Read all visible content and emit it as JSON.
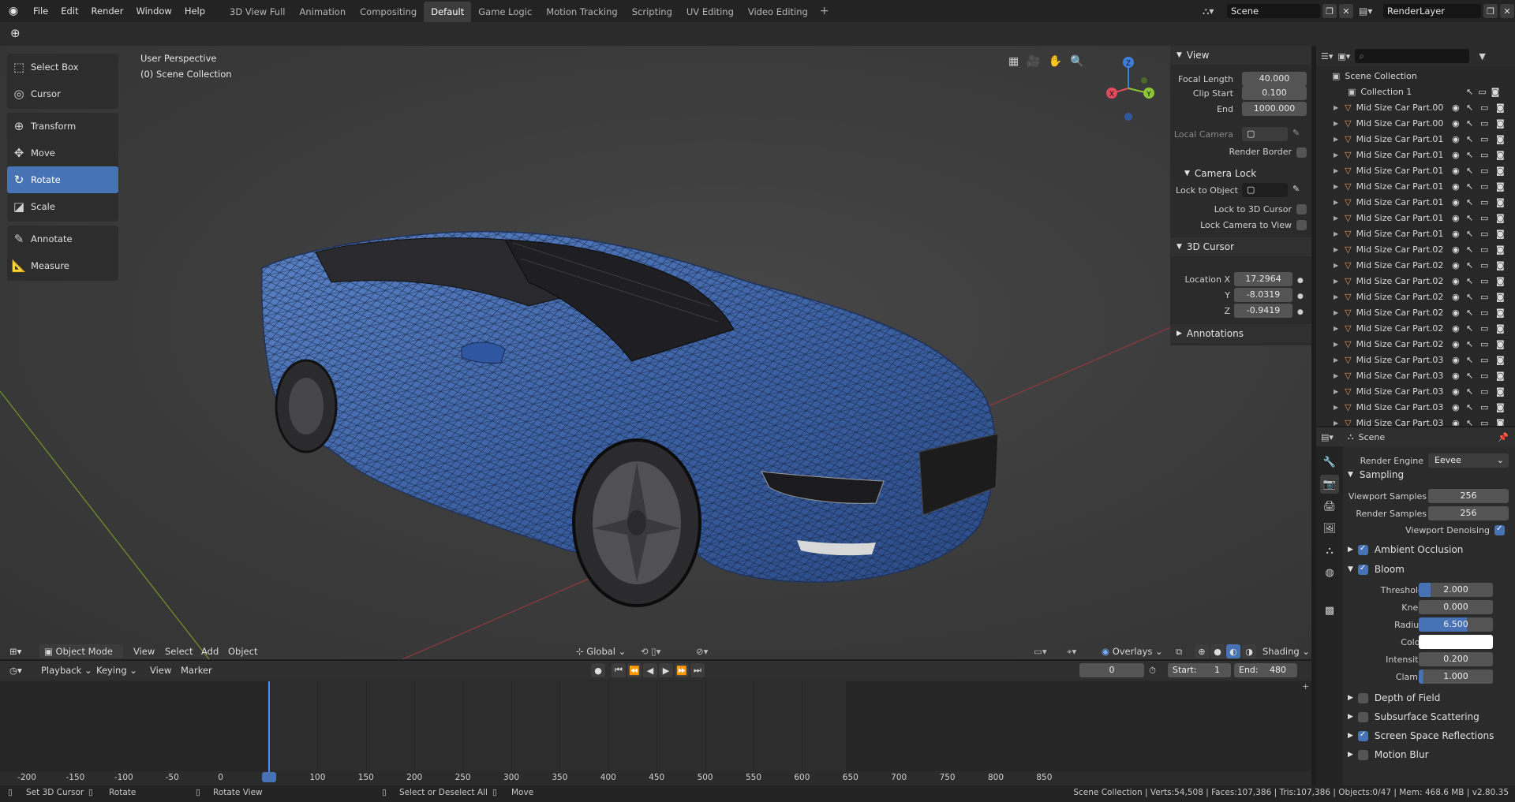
{
  "topbar": {
    "menus": [
      "File",
      "Edit",
      "Render",
      "Window",
      "Help"
    ],
    "workspace_tabs": [
      "3D View Full",
      "Animation",
      "Compositing",
      "Default",
      "Game Logic",
      "Motion Tracking",
      "Scripting",
      "UV Editing",
      "Video Editing"
    ],
    "active_tab": "Default",
    "add_tab": "+",
    "scene_name": "Scene",
    "view_layer": "RenderLayer"
  },
  "viewport": {
    "perspective_label": "User Perspective",
    "collection_label": "(0) Scene Collection",
    "tools": [
      "Select Box",
      "Cursor",
      "Transform",
      "Move",
      "Rotate",
      "Scale",
      "Annotate",
      "Measure"
    ],
    "active_tool": "Rotate",
    "gizmo": {
      "x": "X",
      "y": "Y",
      "z": "Z"
    }
  },
  "npanel": {
    "view_header": "View",
    "focal_length_label": "Focal Length",
    "focal_length": "40.000",
    "clip_start_label": "Clip Start",
    "clip_start": "0.100",
    "clip_end_label": "End",
    "clip_end": "1000.000",
    "local_camera_label": "Local Camera",
    "render_border_label": "Render Border",
    "camera_lock_header": "Camera Lock",
    "lock_to_object_label": "Lock to Object",
    "lock_to_3d_cursor_label": "Lock to 3D Cursor",
    "lock_camera_to_view_label": "Lock Camera to View",
    "cursor_header": "3D Cursor",
    "location_x_label": "Location X",
    "location_x": "17.2964",
    "location_y_label": "Y",
    "location_y": "-8.0319",
    "location_z_label": "Z",
    "location_z": "-0.9419",
    "annotations_header": "Annotations"
  },
  "outliner": {
    "root": "Scene Collection",
    "collection": "Collection 1",
    "items": [
      "Mid Size Car Part.00",
      "Mid Size Car Part.00",
      "Mid Size Car Part.01",
      "Mid Size Car Part.01",
      "Mid Size Car Part.01",
      "Mid Size Car Part.01",
      "Mid Size Car Part.01",
      "Mid Size Car Part.01",
      "Mid Size Car Part.01",
      "Mid Size Car Part.02",
      "Mid Size Car Part.02",
      "Mid Size Car Part.02",
      "Mid Size Car Part.02",
      "Mid Size Car Part.02",
      "Mid Size Car Part.02",
      "Mid Size Car Part.02",
      "Mid Size Car Part.03",
      "Mid Size Car Part.03",
      "Mid Size Car Part.03",
      "Mid Size Car Part.03",
      "Mid Size Car Part.03"
    ]
  },
  "properties": {
    "context": "Scene",
    "render_engine_label": "Render Engine",
    "render_engine": "Eevee",
    "sampling_header": "Sampling",
    "viewport_samples_label": "Viewport Samples",
    "viewport_samples": "256",
    "render_samples_label": "Render Samples",
    "render_samples": "256",
    "viewport_denoising_label": "Viewport Denoising",
    "ambient_occlusion": "Ambient Occlusion",
    "bloom": "Bloom",
    "threshold_label": "Threshold",
    "threshold": "2.000",
    "knee_label": "Knee",
    "knee": "0.000",
    "radius_label": "Radius",
    "radius": "6.500",
    "color_label": "Color",
    "intensity_label": "Intensity",
    "intensity": "0.200",
    "clamp_label": "Clamp",
    "clamp": "1.000",
    "depth_of_field": "Depth of Field",
    "subsurface_scattering": "Subsurface Scattering",
    "screen_space_reflections": "Screen Space Reflections",
    "motion_blur": "Motion Blur"
  },
  "viewport_header": {
    "mode": "Object Mode",
    "menus": [
      "View",
      "Select",
      "Add",
      "Object"
    ],
    "orientation": "Global",
    "overlays": "Overlays",
    "shading": "Shading"
  },
  "timeline": {
    "menus": [
      "Playback",
      "Keying",
      "View",
      "Marker"
    ],
    "current_frame": "0",
    "start_label": "Start:",
    "start": "1",
    "end_label": "End:",
    "end": "480",
    "ticks": [
      "-200",
      "-150",
      "-100",
      "-50",
      "0",
      "50",
      "100",
      "150",
      "200",
      "250",
      "300",
      "350",
      "400",
      "450",
      "500",
      "550",
      "600",
      "650",
      "700",
      "750",
      "800",
      "850"
    ]
  },
  "statusbar": {
    "hint1": "Set 3D Cursor",
    "hint2": "Rotate",
    "hint3": "Rotate View",
    "hint4": "Select or Deselect All",
    "hint5": "Move",
    "stats": "Scene Collection | Verts:54,508 | Faces:107,386 | Tris:107,386 | Objects:0/47 | Mem: 468.6 MB | v2.80.35"
  },
  "colors": {
    "accent": "#4772b3",
    "car_body": "#3f66a8",
    "x_axis": "#e04a5a",
    "y_axis": "#8ac536",
    "z_axis": "#3d7fd9",
    "object_icon": "#e8955a"
  }
}
